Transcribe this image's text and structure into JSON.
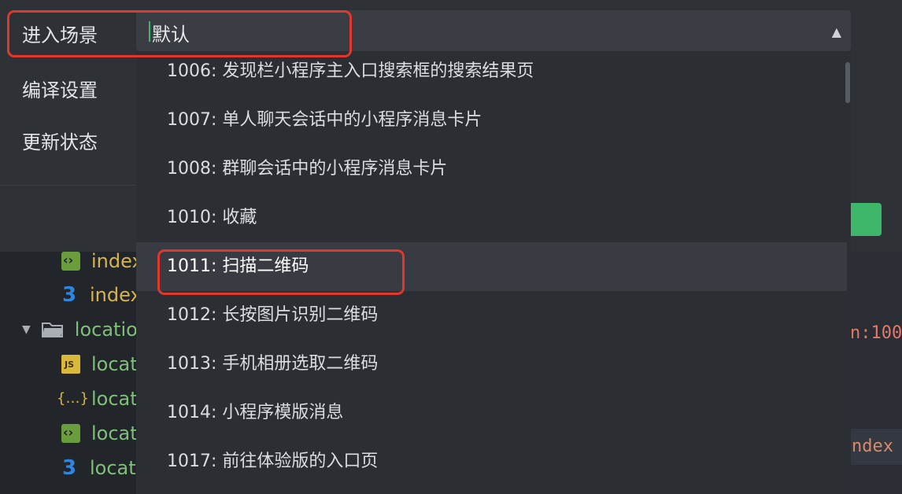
{
  "settings": {
    "scene_label": "进入场景",
    "compile_label": "编译设置",
    "update_label": "更新状态",
    "scene_select": {
      "value": "默认"
    }
  },
  "dropdown": {
    "options": [
      {
        "label": "1006: 发现栏小程序主入口搜索框的搜索结果页",
        "selected": false
      },
      {
        "label": "1007: 单人聊天会话中的小程序消息卡片",
        "selected": false
      },
      {
        "label": "1008: 群聊会话中的小程序消息卡片",
        "selected": false
      },
      {
        "label": "1010: 收藏",
        "selected": false
      },
      {
        "label": "1011: 扫描二维码",
        "selected": true
      },
      {
        "label": "1012: 长按图片识别二维码",
        "selected": false
      },
      {
        "label": "1013: 手机相册选取二维码",
        "selected": false
      },
      {
        "label": "1014: 小程序模版消息",
        "selected": false
      },
      {
        "label": "1017: 前往体验版的入口页",
        "selected": false
      }
    ]
  },
  "file_tree": {
    "items": [
      {
        "label": "index",
        "icon": "html-file-icon"
      },
      {
        "label": "index",
        "icon": "css-file-icon"
      },
      {
        "label": "locatio",
        "icon": "folder-open-icon"
      },
      {
        "label": "locat",
        "icon": "js-file-icon"
      },
      {
        "label": "locat",
        "icon": "json-file-icon"
      },
      {
        "label": "locat",
        "icon": "html-file-icon"
      },
      {
        "label": "locat",
        "icon": "css-file-icon"
      }
    ]
  },
  "editor": {
    "fragment_1": "n:100",
    "fragment_2": "ndex"
  },
  "colors": {
    "highlight_border": "#e0382c",
    "accent_green": "#3fb76a"
  }
}
